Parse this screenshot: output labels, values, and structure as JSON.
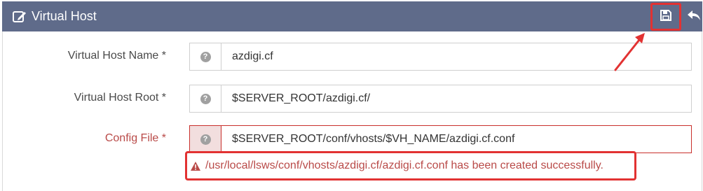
{
  "header": {
    "title": "Virtual Host",
    "save_tooltip": "Save",
    "back_tooltip": "Back"
  },
  "form": {
    "rows": [
      {
        "label": "Virtual Host Name *",
        "value": "azdigi.cf",
        "error": false
      },
      {
        "label": "Virtual Host Root *",
        "value": "$SERVER_ROOT/azdigi.cf/",
        "error": false
      },
      {
        "label": "Config File *",
        "value": "$SERVER_ROOT/conf/vhosts/$VH_NAME/azdigi.cf.conf",
        "error": true
      }
    ],
    "help_glyph": "?"
  },
  "message": {
    "text": "/usr/local/lsws/conf/vhosts/azdigi.cf/azdigi.cf.conf has been created successfully."
  },
  "colors": {
    "header_bg": "#5f6b8a",
    "highlight": "#e23232",
    "error_text": "#b94a48"
  }
}
